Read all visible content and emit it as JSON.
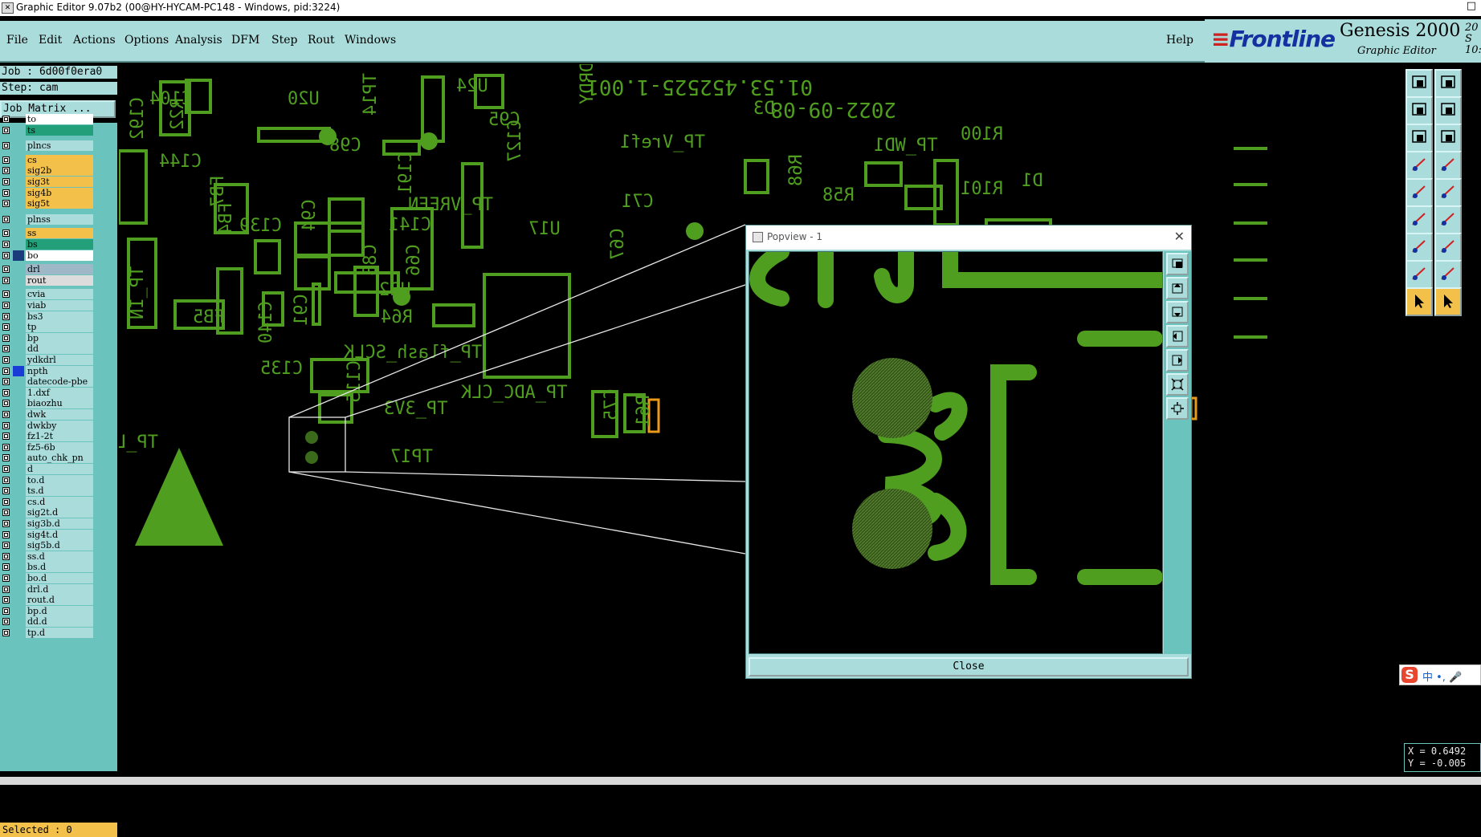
{
  "window": {
    "title": "Graphic Editor 9.07b2 (00@HY-HYCAM-PC148 - Windows, pid:3224)"
  },
  "menu": {
    "items": [
      "File",
      "Edit",
      "Actions",
      "Options",
      "Analysis",
      "DFM",
      "Step",
      "Rout",
      "Windows"
    ],
    "help": "Help"
  },
  "brand": {
    "logo": "Frontline",
    "product": "Genesis 2000",
    "subtitle": "Graphic Editor",
    "version_line1": "20 S",
    "version_line2": "10:"
  },
  "job": {
    "job_label": "Job : 6d00f0era0",
    "step_label": "Step: cam",
    "matrix_button": "Job Matrix ..."
  },
  "layers": [
    {
      "name": "to",
      "color": "#ffffff"
    },
    {
      "name": "ts",
      "color": "#23a07a"
    },
    {
      "name": "plncs",
      "color": "#a9dcdb"
    },
    {
      "name": "cs",
      "color": "#f3c04a"
    },
    {
      "name": "sig2b",
      "color": "#f3c04a"
    },
    {
      "name": "sig3t",
      "color": "#f3c04a"
    },
    {
      "name": "sig4b",
      "color": "#f3c04a"
    },
    {
      "name": "sig5t",
      "color": "#f3c04a"
    },
    {
      "name": "plnss",
      "color": "#a9dcdb"
    },
    {
      "name": "ss",
      "color": "#f3c04a"
    },
    {
      "name": "bs",
      "color": "#23a07a"
    },
    {
      "name": "bo",
      "color": "#ffffff"
    },
    {
      "name": "drl",
      "color": "#9fb8c8"
    },
    {
      "name": "rout",
      "color": "#dcdcdc"
    },
    {
      "name": "cvia",
      "color": "#a9dcdb"
    },
    {
      "name": "viab",
      "color": "#a9dcdb"
    },
    {
      "name": "bs3",
      "color": "#a9dcdb"
    },
    {
      "name": "tp",
      "color": "#a9dcdb"
    },
    {
      "name": "bp",
      "color": "#a9dcdb"
    },
    {
      "name": "dd",
      "color": "#a9dcdb"
    },
    {
      "name": "ydkdrl",
      "color": "#a9dcdb"
    },
    {
      "name": "npth",
      "color": "#a9dcdb"
    },
    {
      "name": "datecode-pbe",
      "color": "#a9dcdb"
    },
    {
      "name": "1.dxf",
      "color": "#a9dcdb"
    },
    {
      "name": "biaozhu",
      "color": "#a9dcdb"
    },
    {
      "name": "dwk",
      "color": "#a9dcdb"
    },
    {
      "name": "dwkby",
      "color": "#a9dcdb"
    },
    {
      "name": "fz1-2t",
      "color": "#a9dcdb"
    },
    {
      "name": "fz5-6b",
      "color": "#a9dcdb"
    },
    {
      "name": "auto_chk_pn",
      "color": "#a9dcdb"
    },
    {
      "name": "d",
      "color": "#a9dcdb"
    },
    {
      "name": "to.d",
      "color": "#a9dcdb"
    },
    {
      "name": "ts.d",
      "color": "#a9dcdb"
    },
    {
      "name": "cs.d",
      "color": "#a9dcdb"
    },
    {
      "name": "sig2t.d",
      "color": "#a9dcdb"
    },
    {
      "name": "sig3b.d",
      "color": "#a9dcdb"
    },
    {
      "name": "sig4t.d",
      "color": "#a9dcdb"
    },
    {
      "name": "sig5b.d",
      "color": "#a9dcdb"
    },
    {
      "name": "ss.d",
      "color": "#a9dcdb"
    },
    {
      "name": "bs.d",
      "color": "#a9dcdb"
    },
    {
      "name": "bo.d",
      "color": "#a9dcdb"
    },
    {
      "name": "drl.d",
      "color": "#a9dcdb"
    },
    {
      "name": "rout.d",
      "color": "#a9dcdb"
    },
    {
      "name": "bp.d",
      "color": "#a9dcdb"
    },
    {
      "name": "dd.d",
      "color": "#a9dcdb"
    },
    {
      "name": "tp.d",
      "color": "#a9dcdb"
    }
  ],
  "status": {
    "selected": "Selected : 0",
    "x": "X = 0.6492",
    "y": "Y = -0.005"
  },
  "board": {
    "part_number": "01.53.452525-1.001",
    "date": "2022-09-08",
    "labels": [
      "C104",
      "U20",
      "U24",
      "C95",
      "TP_ADC_DRDY",
      "D3",
      "R100",
      "C192",
      "R22",
      "TP14",
      "C98",
      "C127",
      "TP_Vref1",
      "TP_WD1",
      "R101",
      "C144",
      "FB7",
      "C191",
      "TP_VREFN",
      "R68",
      "R58",
      "D1",
      "C71",
      "FB4",
      "C139",
      "C94",
      "C141",
      "U17",
      "C83",
      "C66",
      "U22",
      "R64",
      "C67",
      "TP_IN",
      "FB5",
      "C140",
      "C91",
      "C135",
      "TP_flash_SCLK",
      "C115",
      "TP_3V3",
      "TP_ADC_CLK",
      "C75",
      "R61",
      "TP_L",
      "TP17"
    ]
  },
  "popview": {
    "title": "Popview - 1",
    "close_label": "Close"
  },
  "ime": {
    "label": "中 •, 🎤"
  },
  "colors": {
    "panel": "#a9dcdb",
    "trace": "#4f9e1f",
    "highlight": "#f3c04a"
  }
}
